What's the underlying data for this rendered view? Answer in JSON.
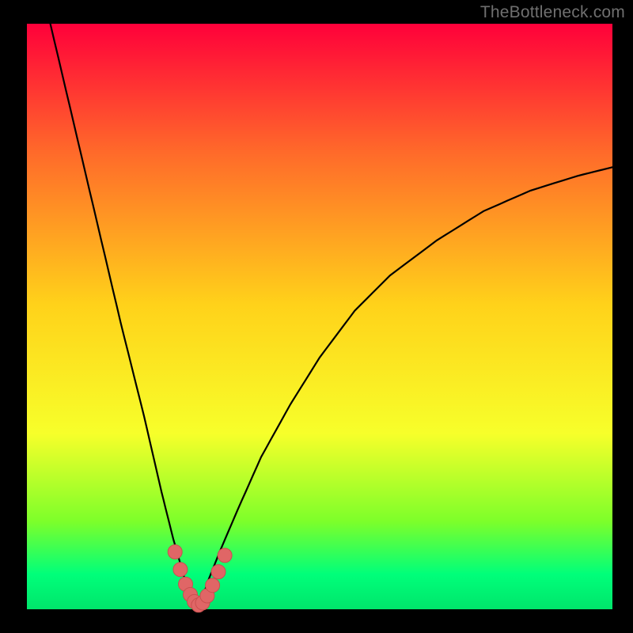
{
  "watermark": "TheBottleneck.com",
  "colors": {
    "black": "#000000",
    "gradient_stops": [
      "#ff003a",
      "#ff6a2a",
      "#ffd21a",
      "#f7ff2a",
      "#7dff2a",
      "#00ff7a",
      "#00e56b"
    ],
    "curve": "#000000",
    "marker_fill": "#e06666",
    "marker_stroke": "#c94f4f"
  },
  "plot": {
    "inner_x": 34,
    "inner_y": 30,
    "inner_w": 740,
    "inner_h": 740
  },
  "chart_data": {
    "type": "line",
    "title": "",
    "xlabel": "",
    "ylabel": "",
    "xlim": [
      0,
      100
    ],
    "ylim": [
      0,
      100
    ],
    "note": "Axes have no visible tick labels; values are percent of plot extent (0=left/bottom, 100=right/top). Curve minimum at x≈29.",
    "series": [
      {
        "name": "curve",
        "x": [
          4,
          8,
          12,
          16,
          20,
          23,
          25,
          27,
          28,
          29,
          30,
          31,
          33,
          36,
          40,
          45,
          50,
          56,
          62,
          70,
          78,
          86,
          94,
          100
        ],
        "values": [
          100,
          83,
          66,
          49,
          33,
          20,
          12,
          5,
          2,
          0.5,
          2,
          5,
          10,
          17,
          26,
          35,
          43,
          51,
          57,
          63,
          68,
          71.5,
          74,
          75.5
        ]
      }
    ],
    "markers": {
      "name": "highlight-segment",
      "x": [
        25.3,
        26.2,
        27.1,
        27.9,
        28.6,
        29.3,
        30.0,
        30.8,
        31.7,
        32.7,
        33.8
      ],
      "values": [
        9.8,
        6.8,
        4.3,
        2.5,
        1.3,
        0.7,
        1.1,
        2.3,
        4.1,
        6.4,
        9.2
      ]
    }
  }
}
